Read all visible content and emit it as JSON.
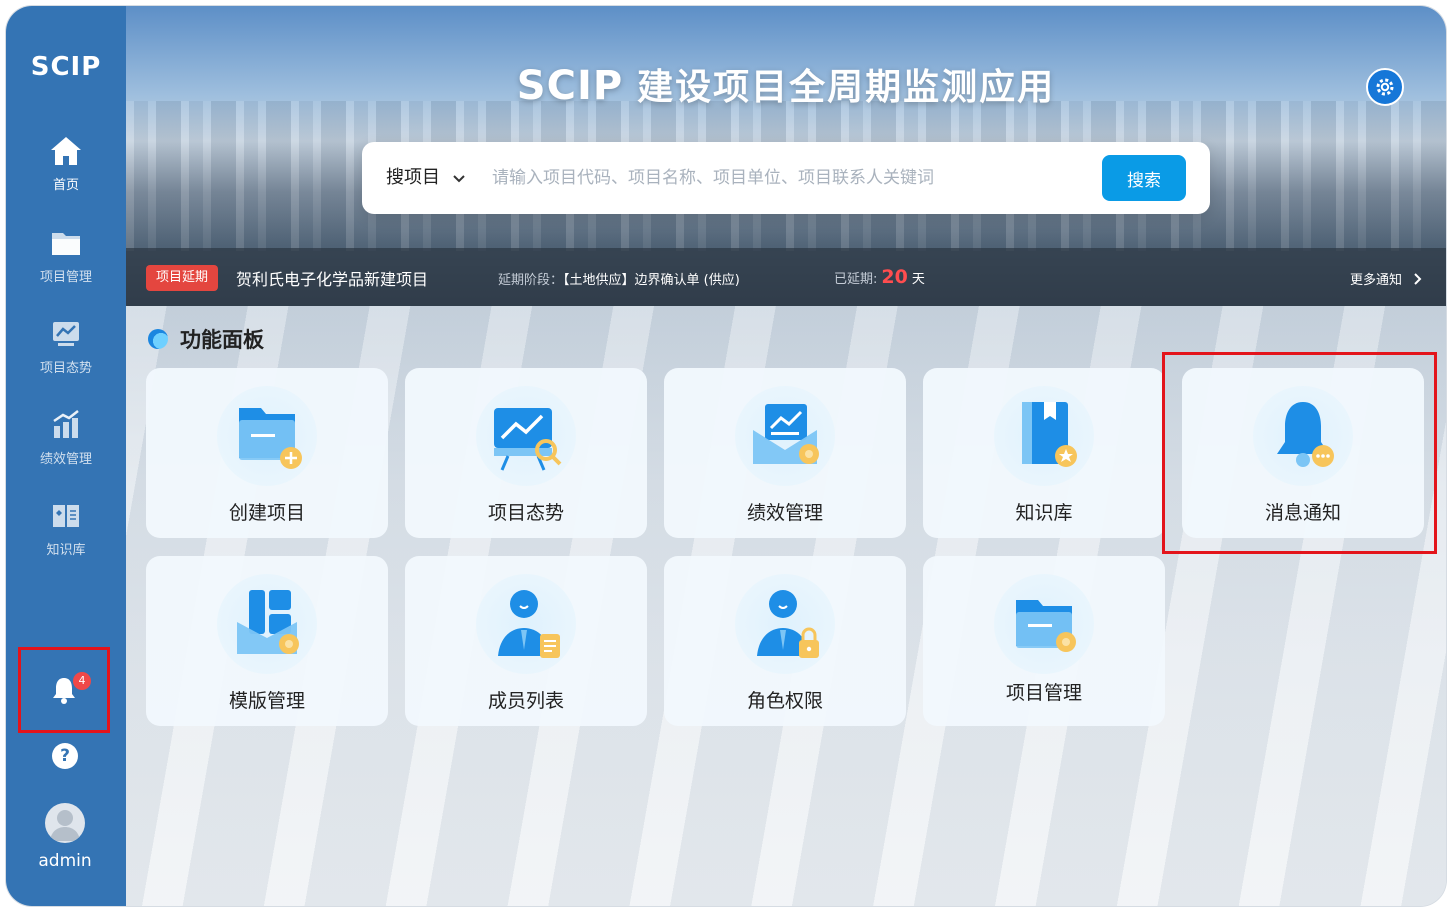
{
  "sidebar": {
    "logo": "SCIP",
    "items": [
      {
        "label": "首页",
        "icon": "home-icon",
        "active": true
      },
      {
        "label": "项目管理",
        "icon": "folder-icon",
        "active": false
      },
      {
        "label": "项目态势",
        "icon": "trend-icon",
        "active": false
      },
      {
        "label": "绩效管理",
        "icon": "bar-chart-icon",
        "active": false
      },
      {
        "label": "知识库",
        "icon": "book-icon",
        "active": false
      }
    ],
    "notification_badge": "4",
    "help_glyph": "?",
    "user_name": "admin"
  },
  "header": {
    "brand": "SCIP",
    "title": "建设项目全周期监测应用",
    "gear_icon": "gear-icon"
  },
  "search": {
    "type_label": "搜项目",
    "placeholder": "请输入项目代码、项目名称、项目单位、项目联系人关键词",
    "button_label": "搜索"
  },
  "notice": {
    "tag": "项目延期",
    "project_name": "贺利氏电子化学品新建项目",
    "stage_label": "延期阶段：",
    "stage_value": "【土地供应】边界确认单 (供应)",
    "delay_label": "已延期:",
    "delay_days": "20",
    "delay_unit": "天",
    "more_label": "更多通知"
  },
  "panel": {
    "title": "功能面板",
    "cards": [
      {
        "label": "创建项目",
        "icon": "folder-add-icon"
      },
      {
        "label": "项目态势",
        "icon": "presentation-chart-icon"
      },
      {
        "label": "绩效管理",
        "icon": "performance-envelope-icon"
      },
      {
        "label": "知识库",
        "icon": "knowledge-book-icon"
      },
      {
        "label": "消息通知",
        "icon": "bell-icon"
      },
      {
        "label": "模版管理",
        "icon": "template-icon"
      },
      {
        "label": "成员列表",
        "icon": "member-list-icon"
      },
      {
        "label": "角色权限",
        "icon": "role-lock-icon"
      },
      {
        "label": "项目管理",
        "icon": "folder-settings-icon"
      }
    ]
  },
  "colors": {
    "sidebar": "#3474b4",
    "accent": "#0a9be6",
    "alert": "#e4463f",
    "highlight": "#e3141b"
  }
}
